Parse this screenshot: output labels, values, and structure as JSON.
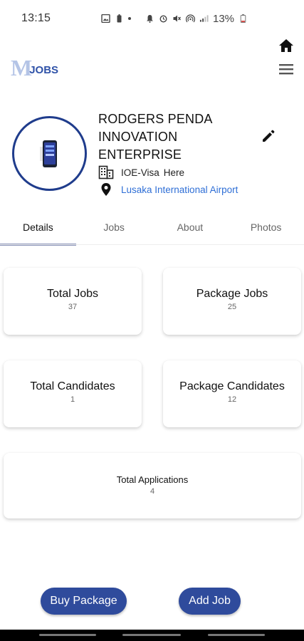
{
  "status_bar": {
    "time": "13:15",
    "battery_percent": "13%"
  },
  "header": {
    "logo_mark": "M",
    "logo_text": "JOBS"
  },
  "profile": {
    "company_name": "RODGERS PENDA INNOVATION ENTERPRISE",
    "visa_label": "IOE-Visa",
    "visa_link": "Here",
    "location": "Lusaka International Airport"
  },
  "tabs": [
    {
      "label": "Details",
      "active": true
    },
    {
      "label": "Jobs",
      "active": false
    },
    {
      "label": "About",
      "active": false
    },
    {
      "label": "Photos",
      "active": false
    }
  ],
  "stats": {
    "total_jobs": {
      "label": "Total Jobs",
      "value": "37"
    },
    "package_jobs": {
      "label": "Package Jobs",
      "value": "25"
    },
    "total_candidates": {
      "label": "Total Candidates",
      "value": "1"
    },
    "package_candidates": {
      "label": "Package Candidates",
      "value": "12"
    },
    "total_applications": {
      "label": "Total Applications",
      "value": "4"
    }
  },
  "actions": {
    "buy_package": "Buy Package",
    "add_job": "Add Job"
  },
  "colors": {
    "primary": "#2f4b9c",
    "avatar_border": "#1f3c8c",
    "link": "#2f6fd6",
    "tab_indicator": "#8a93b8"
  },
  "icons": [
    "home-icon",
    "menu-icon",
    "edit-icon",
    "building-icon",
    "location-pin-icon"
  ]
}
